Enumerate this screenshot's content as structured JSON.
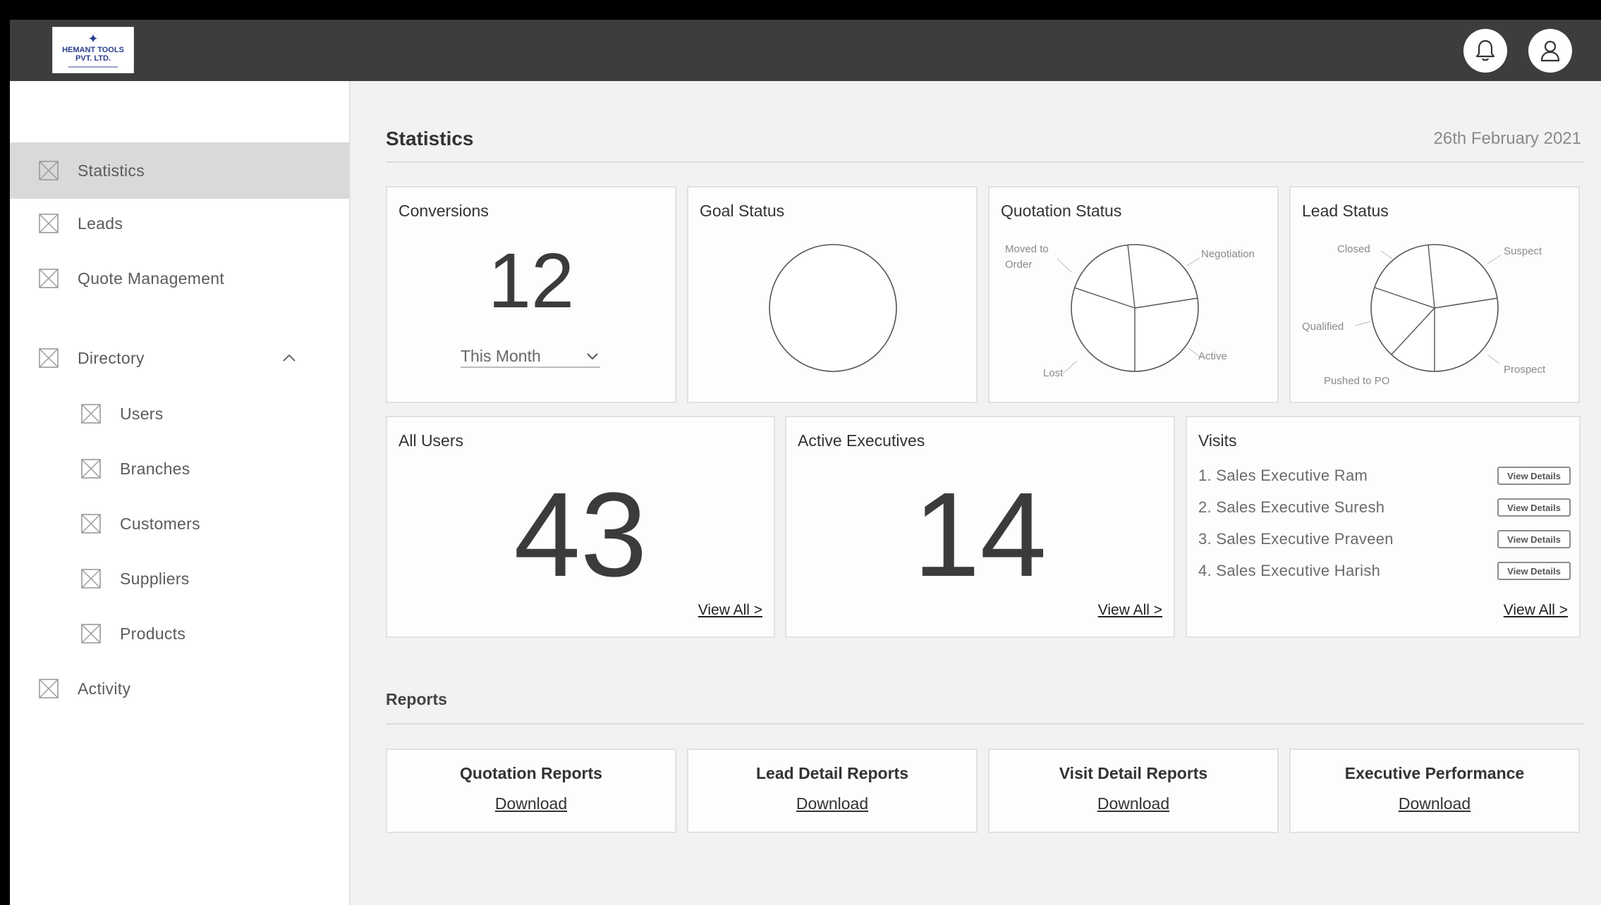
{
  "header": {
    "logo_text_line1": "HEMANT TOOLS",
    "logo_text_line2": "PVT. LTD.",
    "icons": [
      "bell-icon",
      "user-icon"
    ]
  },
  "sidebar": {
    "items": [
      {
        "label": "Statistics",
        "active": true
      },
      {
        "label": "Leads"
      },
      {
        "label": "Quote Management"
      },
      {
        "label": "Directory",
        "expanded": true
      },
      {
        "label": "Users",
        "child": true
      },
      {
        "label": "Branches",
        "child": true
      },
      {
        "label": "Customers",
        "child": true
      },
      {
        "label": "Suppliers",
        "child": true
      },
      {
        "label": "Products",
        "child": true
      },
      {
        "label": "Activity"
      }
    ]
  },
  "main": {
    "title": "Statistics",
    "date": "26th February 2021",
    "conversions": {
      "title": "Conversions",
      "value": "12",
      "period": "This Month"
    },
    "goal_status": {
      "title": "Goal Status"
    },
    "quotation_status": {
      "title": "Quotation Status",
      "labels": [
        "Moved to",
        "Order",
        "Negotiation",
        "Active",
        "Lost"
      ]
    },
    "lead_status": {
      "title": "Lead Status",
      "labels": [
        "Closed",
        "Suspect",
        "Qualified",
        "Prospect",
        "Pushed to PO"
      ]
    },
    "all_users": {
      "title": "All Users",
      "value": "43",
      "link": "View All >"
    },
    "active_executives": {
      "title": "Active Executives",
      "value": "14",
      "link": "View All >"
    },
    "visits": {
      "title": "Visits",
      "items": [
        {
          "text": "1.  Sales Executive Ram",
          "button": "View Details"
        },
        {
          "text": "2.  Sales Executive Suresh",
          "button": "View Details"
        },
        {
          "text": "3.  Sales Executive Praveen",
          "button": "View Details"
        },
        {
          "text": "4.  Sales Executive Harish",
          "button": "View Details"
        }
      ],
      "link": "View All >"
    },
    "reports": {
      "title": "Reports",
      "items": [
        {
          "name": "Quotation Reports",
          "link": "Download"
        },
        {
          "name": "Lead Detail Reports",
          "link": "Download"
        },
        {
          "name": "Visit Detail Reports",
          "link": "Download"
        },
        {
          "name": "Executive Performance",
          "link": "Download"
        }
      ]
    }
  },
  "colors": {
    "topbar": "#3d3d3d",
    "background": "#f2f2f2",
    "active_nav": "#d9d9d9",
    "card_border": "#e1e1e1"
  }
}
